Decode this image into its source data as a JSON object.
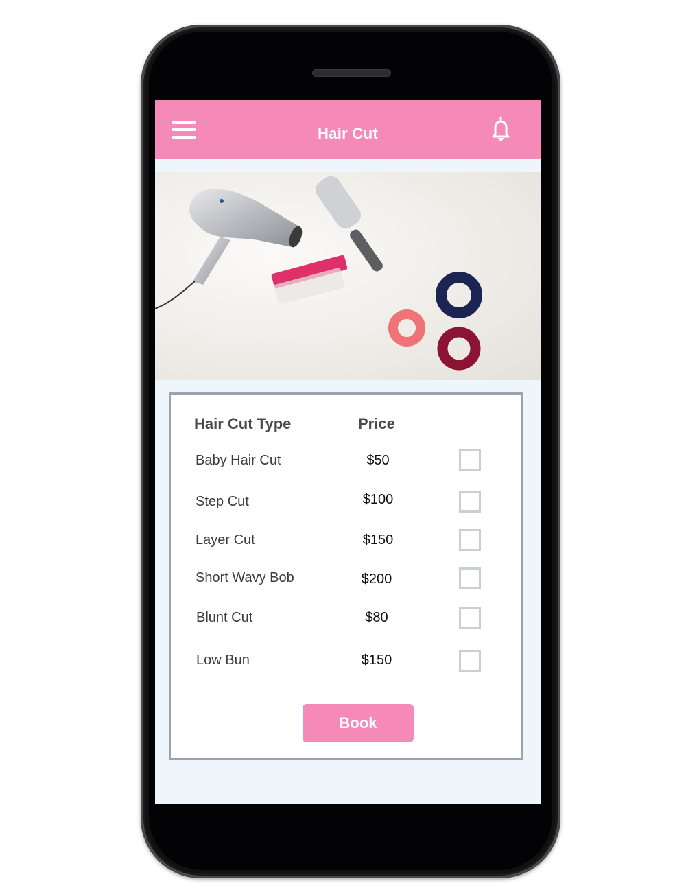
{
  "app": {
    "title": "Hair Cut",
    "accent_color": "#f589b8",
    "icons": {
      "menu": "hamburger-menu-icon",
      "notifications": "bell-icon"
    }
  },
  "hero_image": {
    "description": "Hair styling tools on white fur: silver hair dryer, round brush, pink comb, and three velvet scrunchies (pink, navy, burgundy)"
  },
  "table": {
    "headers": {
      "type": "Hair Cut Type",
      "price": "Price"
    },
    "rows": [
      {
        "name": "Baby Hair Cut",
        "price": "$50",
        "checked": false
      },
      {
        "name": "Step Cut",
        "price": "$100",
        "checked": false
      },
      {
        "name": "Layer Cut",
        "price": "$150",
        "checked": false
      },
      {
        "name": "Short Wavy Bob",
        "price": "$200",
        "checked": false
      },
      {
        "name": "Blunt Cut",
        "price": "$80",
        "checked": false
      },
      {
        "name": "Low Bun",
        "price": "$150",
        "checked": false
      }
    ]
  },
  "actions": {
    "book_label": "Book"
  }
}
